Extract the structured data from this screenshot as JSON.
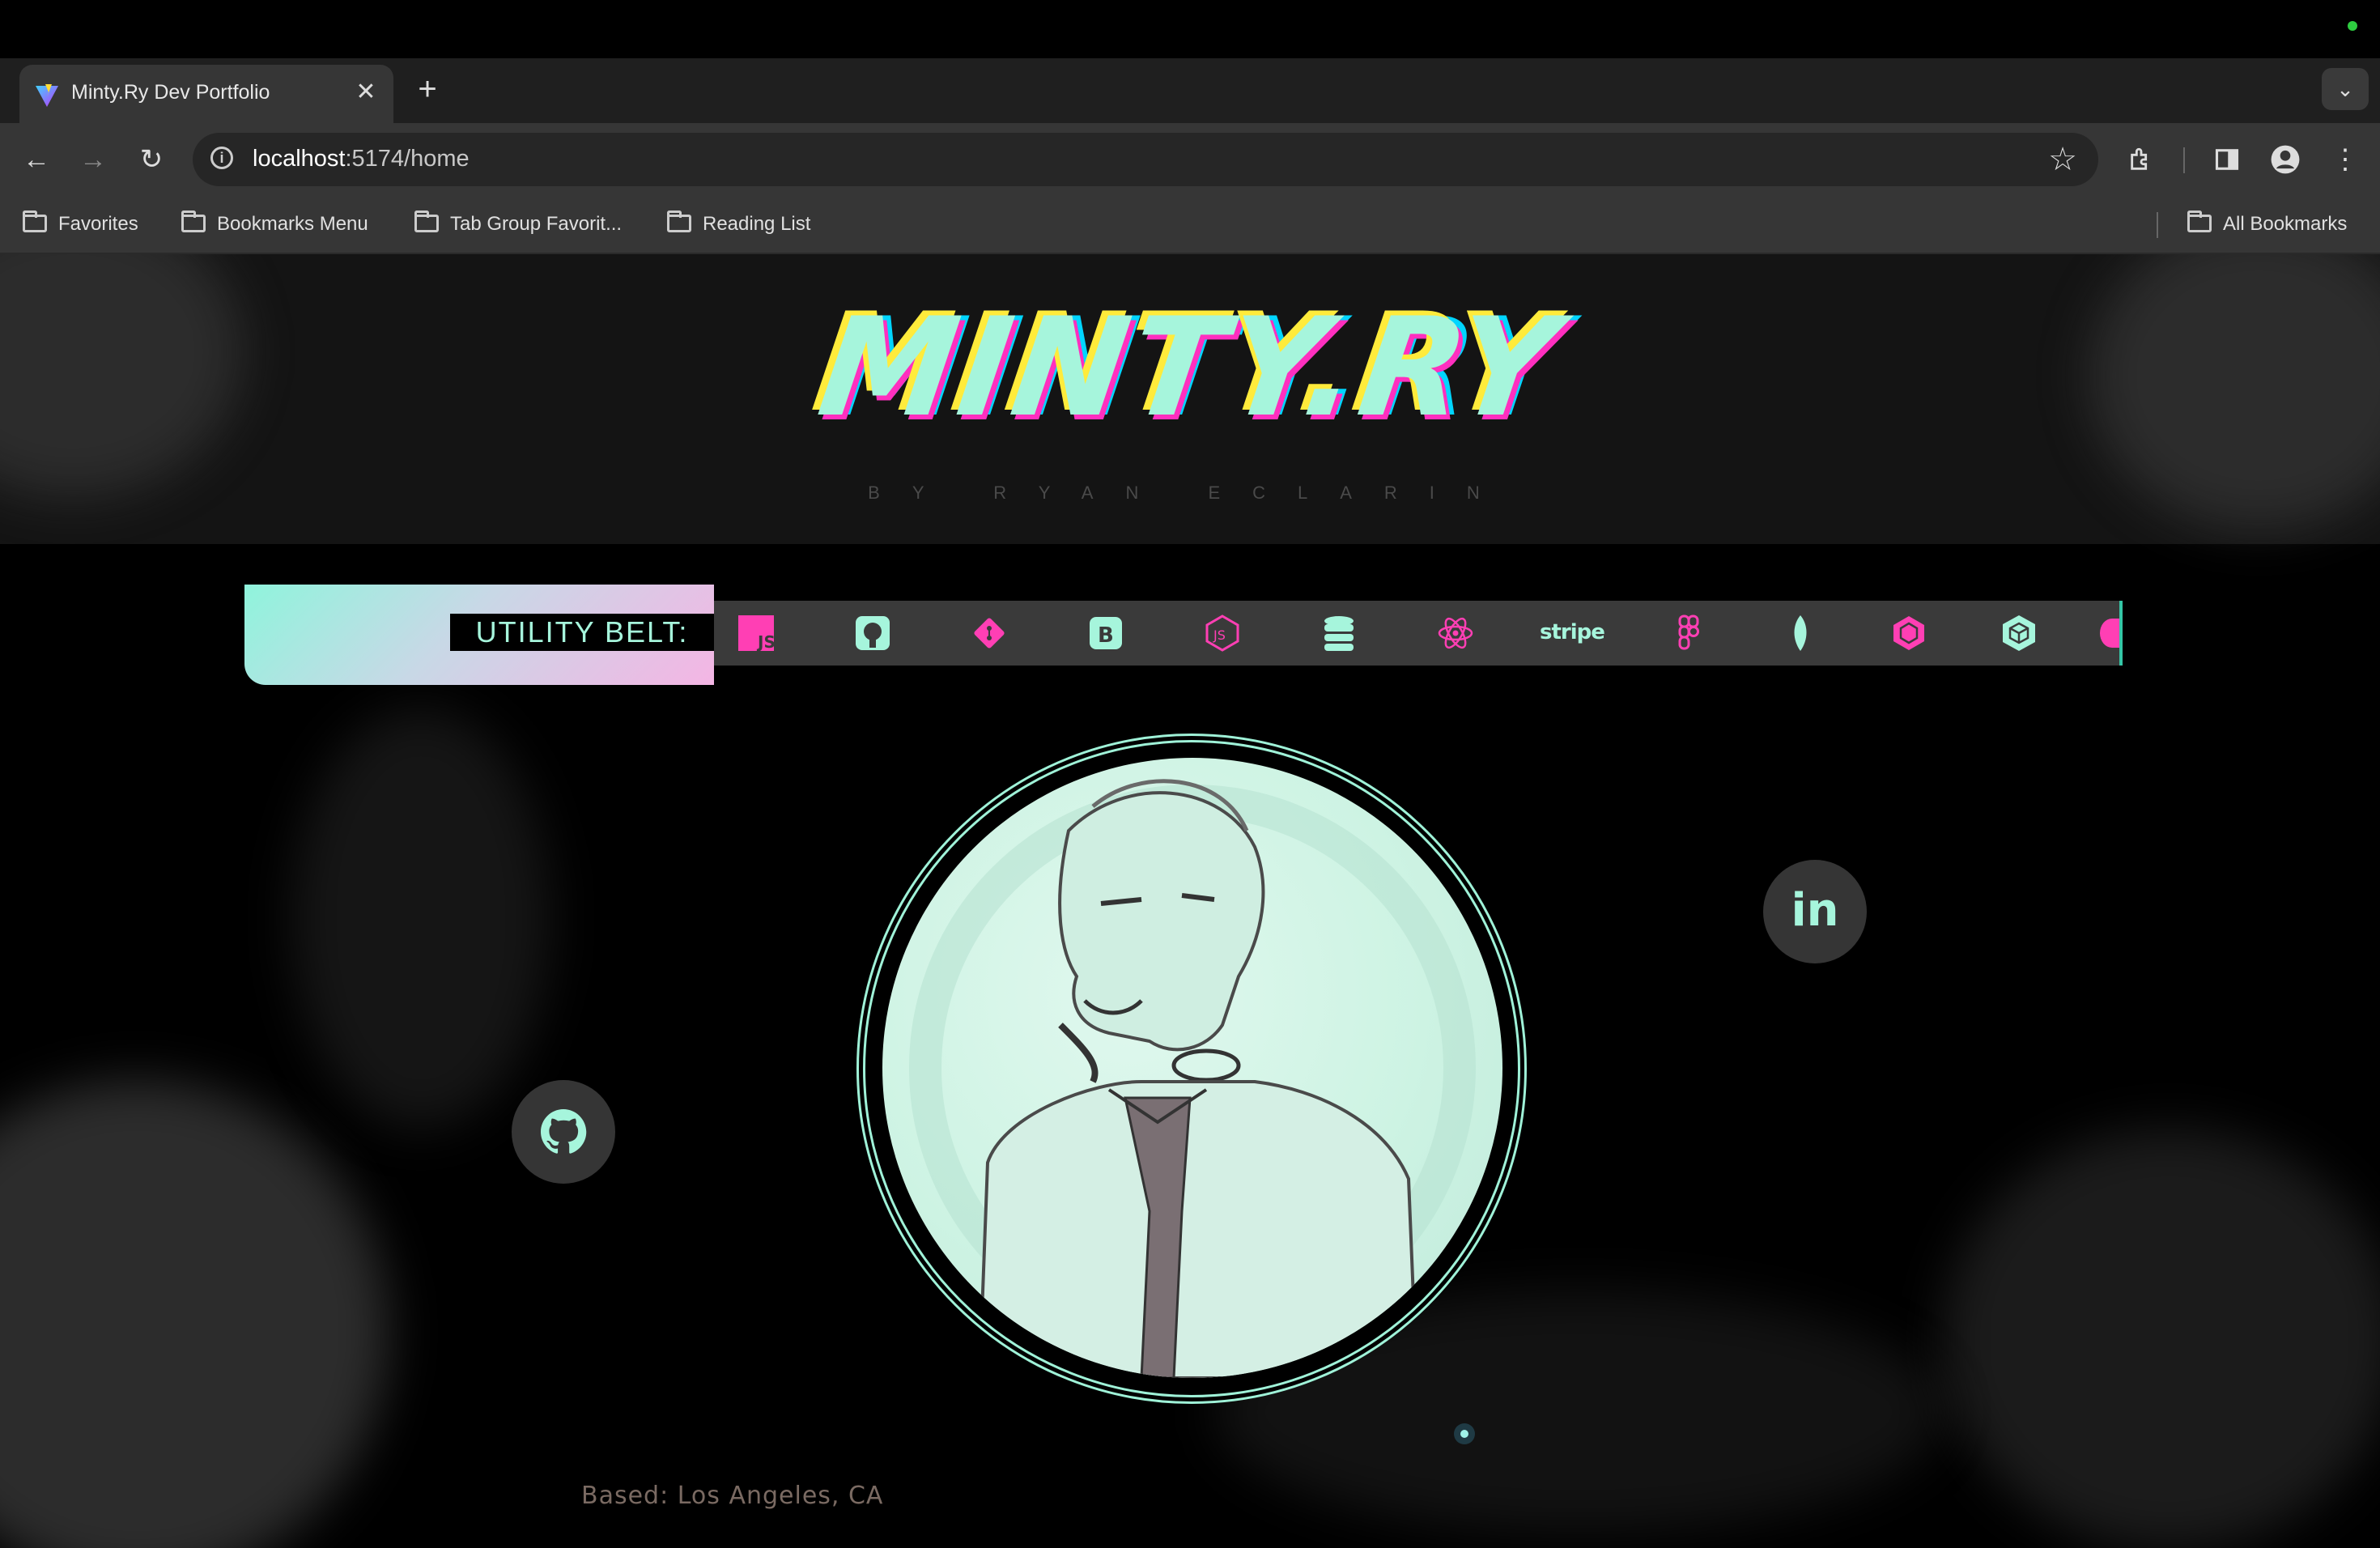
{
  "browser": {
    "tab_title": "Minty.Ry Dev Portfolio",
    "new_tab_label": "+",
    "url_host": "localhost",
    "url_path": ":5174/home",
    "bookmarks": [
      "Favorites",
      "Bookmarks Menu",
      "Tab Group Favorit...",
      "Reading List"
    ],
    "all_bookmarks": "All Bookmarks"
  },
  "header": {
    "logo": "MINTY.RY",
    "byline": "BY RYAN ECLARIN"
  },
  "utility_belt": {
    "label": "UTILITY BELT:",
    "tools": [
      "javascript-icon",
      "github-icon",
      "git-icon",
      "bootstrap-icon",
      "nodejs-icon",
      "database-icon",
      "react-icon",
      "stripe",
      "figma-icon",
      "mongodb-icon",
      "webpack-icon",
      "codesandbox-icon"
    ],
    "stripe_label": "stripe"
  },
  "social": {
    "linkedin_label": "in"
  },
  "footer": {
    "location": "Based: Los Angeles, CA"
  },
  "colors": {
    "mint": "#a6f5dc",
    "pink": "#ff3fb4",
    "chrome_dark": "#1f1f1f",
    "chrome_mid": "#363636"
  }
}
